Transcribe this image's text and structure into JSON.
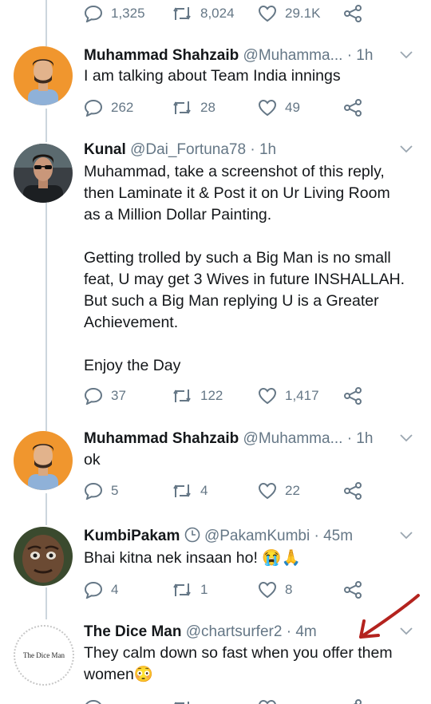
{
  "top_actions": {
    "replies": "1,325",
    "retweets": "8,024",
    "likes": "29.1K"
  },
  "tweets": [
    {
      "name": "Muhammad Shahzaib",
      "handle": "@Muhamma...",
      "time": "1h",
      "text": "I am talking about  Team India innings",
      "replies": "262",
      "retweets": "28",
      "likes": "49"
    },
    {
      "name": "Kunal",
      "handle": "@Dai_Fortuna78",
      "time": "1h",
      "text_lines": [
        "Muhammad, take a screenshot of this reply,",
        "then Laminate it & Post it on Ur Living Room",
        "as a Million Dollar Painting.",
        "",
        "Getting trolled by such a Big Man is no small",
        "feat, U may get 3 Wives in future INSHALLAH.",
        "But such a Big Man replying U is a Greater",
        "Achievement.",
        "",
        "Enjoy the Day"
      ],
      "replies": "37",
      "retweets": "122",
      "likes": "1,417"
    },
    {
      "name": "Muhammad Shahzaib",
      "handle": "@Muhamma...",
      "time": "1h",
      "text": "ok",
      "replies": "5",
      "retweets": "4",
      "likes": "22"
    },
    {
      "name": "KumbiPakam",
      "handle": "@PakamKumbi",
      "time": "45m",
      "text": "Bhai kitna nek insaan ho! 😭🙏",
      "replies": "4",
      "retweets": "1",
      "likes": "8"
    },
    {
      "name": "The Dice Man",
      "handle": "@chartsurfer2",
      "time": "4m",
      "avatar_text": "The Dice Man",
      "text_lines": [
        "They  calm down so fast when you offer them",
        "women😳"
      ]
    }
  ],
  "colors": {
    "gray": "#657786",
    "thread": "#ccd6dd",
    "annotation_arrow": "#b4231e"
  }
}
